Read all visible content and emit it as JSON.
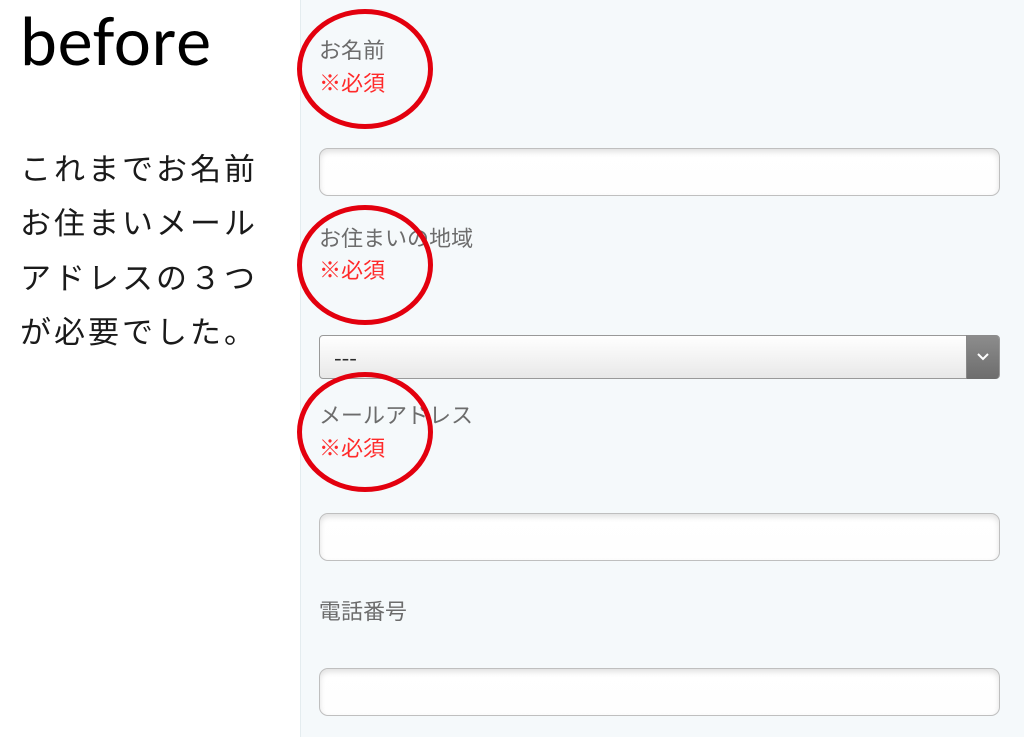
{
  "title": "before",
  "caption": "これまでお名前お住まいメールアドレスの３つが必要でした。",
  "required_text": "※必須",
  "fields": {
    "name": {
      "label": "お名前"
    },
    "region": {
      "label": "お住まいの地域",
      "selected": "---"
    },
    "email": {
      "label": "メールアドレス"
    },
    "phone": {
      "label": "電話番号"
    }
  }
}
